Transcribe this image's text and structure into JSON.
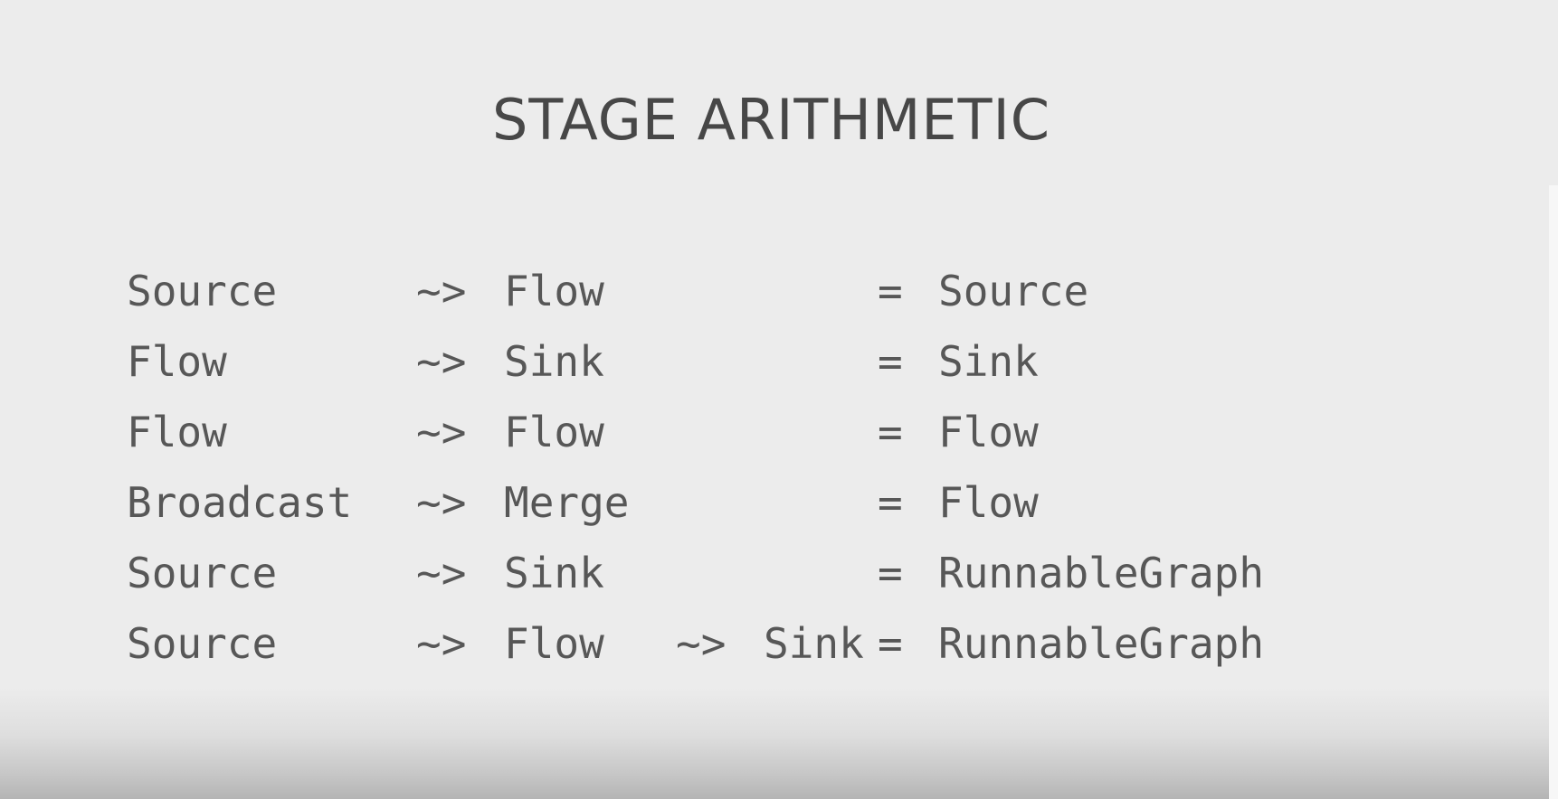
{
  "slide": {
    "title": "STAGE ARITHMETIC",
    "rows": [
      {
        "a": "Source",
        "op1": "~>",
        "b": "Flow",
        "op2": "",
        "c": "",
        "eq": "=",
        "result": "Source"
      },
      {
        "a": "Flow",
        "op1": "~>",
        "b": "Sink",
        "op2": "",
        "c": "",
        "eq": "=",
        "result": "Sink"
      },
      {
        "a": "Flow",
        "op1": "~>",
        "b": "Flow",
        "op2": "",
        "c": "",
        "eq": "=",
        "result": "Flow"
      },
      {
        "a": "Broadcast",
        "op1": "~>",
        "b": "Merge",
        "op2": "",
        "c": "",
        "eq": "=",
        "result": "Flow"
      },
      {
        "a": "Source",
        "op1": "~>",
        "b": "Sink",
        "op2": "",
        "c": "",
        "eq": "=",
        "result": "RunnableGraph"
      },
      {
        "a": "Source",
        "op1": "~>",
        "b": "Flow",
        "op2": "~>",
        "c": "Sink",
        "eq": "=",
        "result": "RunnableGraph"
      }
    ]
  }
}
